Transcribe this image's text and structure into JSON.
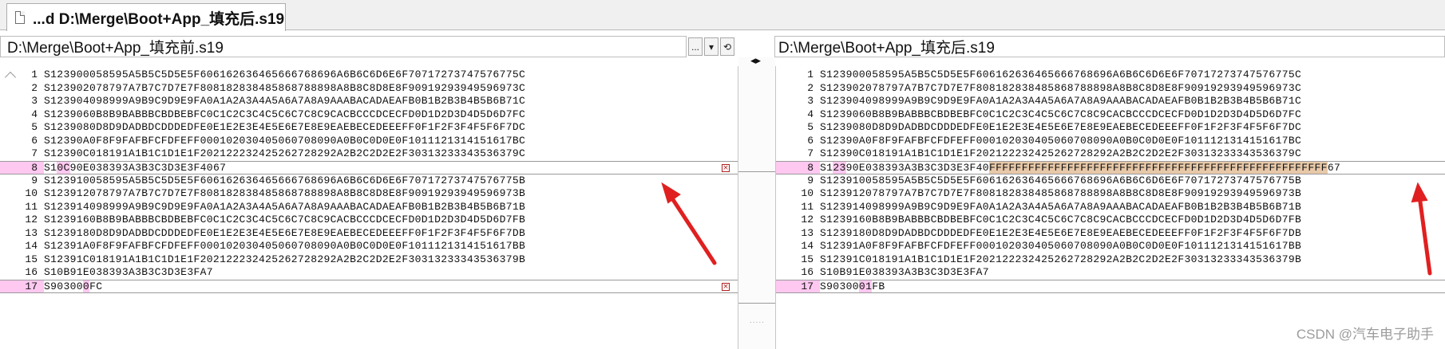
{
  "tab": {
    "title": "...d D:\\Merge\\Boot+App_填充后.s19",
    "icon": "document-icon"
  },
  "left": {
    "path": "D:\\Merge\\Boot+App_填充前.s19",
    "buttons": {
      "browse": "...",
      "dropdown": "▾",
      "refresh": "⟲"
    }
  },
  "right": {
    "path": "D:\\Merge\\Boot+App_填充后.s19"
  },
  "gutter": {
    "arrows": "◂▸"
  },
  "left_lines": [
    {
      "n": "1",
      "t": "S123900058595A5B5C5D5E5F606162636465666768696A6B6C6D6E6F70717273747576775C"
    },
    {
      "n": "2",
      "t": "S123902078797A7B7C7D7E7F808182838485868788898A8B8C8D8E8F90919293949596973C"
    },
    {
      "n": "3",
      "t": "S123904098999A9B9C9D9E9FA0A1A2A3A4A5A6A7A8A9AAABACADAEAFB0B1B2B3B4B5B6B71C"
    },
    {
      "n": "4",
      "t": "S1239060B8B9BABBBCBDBEBFC0C1C2C3C4C5C6C7C8C9CACBCCCDCECFD0D1D2D3D4D5D6D7FC"
    },
    {
      "n": "5",
      "t": "S1239080D8D9DADBDCDDDEDFE0E1E2E3E4E5E6E7E8E9EAEBECEDEEEFF0F1F2F3F4F5F6F7DC"
    },
    {
      "n": "6",
      "t": "S12390A0F8F9FAFBFCFDFEFF000102030405060708090A0B0C0D0E0F101112131415161​7BC"
    },
    {
      "n": "7",
      "t": "S12390C018191A1B1C1D1E1F202122232425262728292A2B2C2D2E2F30313233343536379C"
    },
    {
      "n": "8",
      "a": "S1",
      "b": "0C",
      "c": "90E038393A3B3C3D3E3F40",
      "d": "",
      "e": "67"
    },
    {
      "n": "9",
      "t": "S123910058595A5B5C5D5E5F606162636465666768696A6B6C6D6E6F70717273747576775B"
    },
    {
      "n": "10",
      "t": "S123912078797A7B7C7D7E7F808182838485868788898A8B8C8D8E8F90919293949596973B"
    },
    {
      "n": "11",
      "t": "S123914098999A9B9C9D9E9FA0A1A2A3A4A5A6A7A8A9AAABACADAEAFB0B1B2B3B4B5B6B71B"
    },
    {
      "n": "12",
      "t": "S1239160B8B9BABBBCBDBEBFC0C1C2C3C4C5C6C7C8C9CACBCCCDCECFD0D1D2D3D4D5D6D7FB"
    },
    {
      "n": "13",
      "t": "S1239180D8D9DADBDCDDDEDFE0E1E2E3E4E5E6E7E8E9EAEBECEDEEEFF0F1F2F3F4F5F6F7DB"
    },
    {
      "n": "14",
      "t": "S12391A0F8F9FAFBFCFDFEFF000102030405060708090A0B0C0D0E0F101112131415161​7BB"
    },
    {
      "n": "15",
      "t": "S12391C018191A1B1C1D1E1F202122232425262728292A2B2C2D2E2F30313233343536379B"
    },
    {
      "n": "16",
      "t": "S10B91E038393A3B3C3D3E3FA7"
    },
    {
      "n": "17",
      "a": "S90300",
      "b": "0",
      "c": "",
      "d": "",
      "e": "FC"
    }
  ],
  "right_lines": [
    {
      "n": "1",
      "t": "S123900058595A5B5C5D5E5F606162636465666768696A6B6C6D6E6F70717273747576775C"
    },
    {
      "n": "2",
      "t": "S123902078797A7B7C7D7E7F808182838485868788898A8B8C8D8E8F90919293949596973C"
    },
    {
      "n": "3",
      "t": "S123904098999A9B9C9D9E9FA0A1A2A3A4A5A6A7A8A9AAABACADAEAFB0B1B2B3B4B5B6B71C"
    },
    {
      "n": "4",
      "t": "S1239060B8B9BABBBCBDBEBFC0C1C2C3C4C5C6C7C8C9CACBCCCDCECFD0D1D2D3D4D5D6D7FC"
    },
    {
      "n": "5",
      "t": "S1239080D8D9DADBDCDDDEDFE0E1E2E3E4E5E6E7E8E9EAEBECEDEEEFF0F1F2F3F4F5F6F7DC"
    },
    {
      "n": "6",
      "t": "S12390A0F8F9FAFBFCFDFEFF000102030405060708090A0B0C0D0E0F101112131415161​7BC"
    },
    {
      "n": "7",
      "t": "S12390C018191A1B1C1D1E1F202122232425262728292A2B2C2D2E2F30313233343536379C"
    },
    {
      "n": "8",
      "a": "S1",
      "b": "23",
      "c": "90E038393A3B3C3D3E3F40",
      "d": "FFFFFFFFFFFFFFFFFFFFFFFFFFFFFFFFFFFFFFFFFFFFFFFFFFFF",
      "e": "67"
    },
    {
      "n": "9",
      "t": "S123910058595A5B5C5D5E5F606162636465666768696A6B6C6D6E6F70717273747576775B"
    },
    {
      "n": "10",
      "t": "S123912078797A7B7C7D7E7F808182838485868788898A8B8C8D8E8F90919293949596973B"
    },
    {
      "n": "11",
      "t": "S123914098999A9B9C9D9E9FA0A1A2A3A4A5A6A7A8A9AAABACADAEAFB0B1B2B3B4B5B6B71B"
    },
    {
      "n": "12",
      "t": "S1239160B8B9BABBBCBDBEBFC0C1C2C3C4C5C6C7C8C9CACBCCCDCECFD0D1D2D3D4D5D6D7FB"
    },
    {
      "n": "13",
      "t": "S1239180D8D9DADBDCDDDEDFE0E1E2E3E4E5E6E7E8E9EAEBECEDEEEFF0F1F2F3F4F5F6F7DB"
    },
    {
      "n": "14",
      "t": "S12391A0F8F9FAFBFCFDFEFF000102030405060708090A0B0C0D0E0F101112131415161​7BB"
    },
    {
      "n": "15",
      "t": "S12391C018191A1B1C1D1E1F202122232425262728292A2B2C2D2E2F30313233343536379B"
    },
    {
      "n": "16",
      "t": "S10B91E038393A3B3C3D3E3FA7"
    },
    {
      "n": "17",
      "a": "S90300",
      "b": "01",
      "c": "",
      "d": "",
      "e": "FB"
    }
  ],
  "watermark": "CSDN @汽车电子助手",
  "colors": {
    "diff_line": "#ffc8f0",
    "inserted": "#e7c8a8",
    "annotation": "#e02020"
  }
}
